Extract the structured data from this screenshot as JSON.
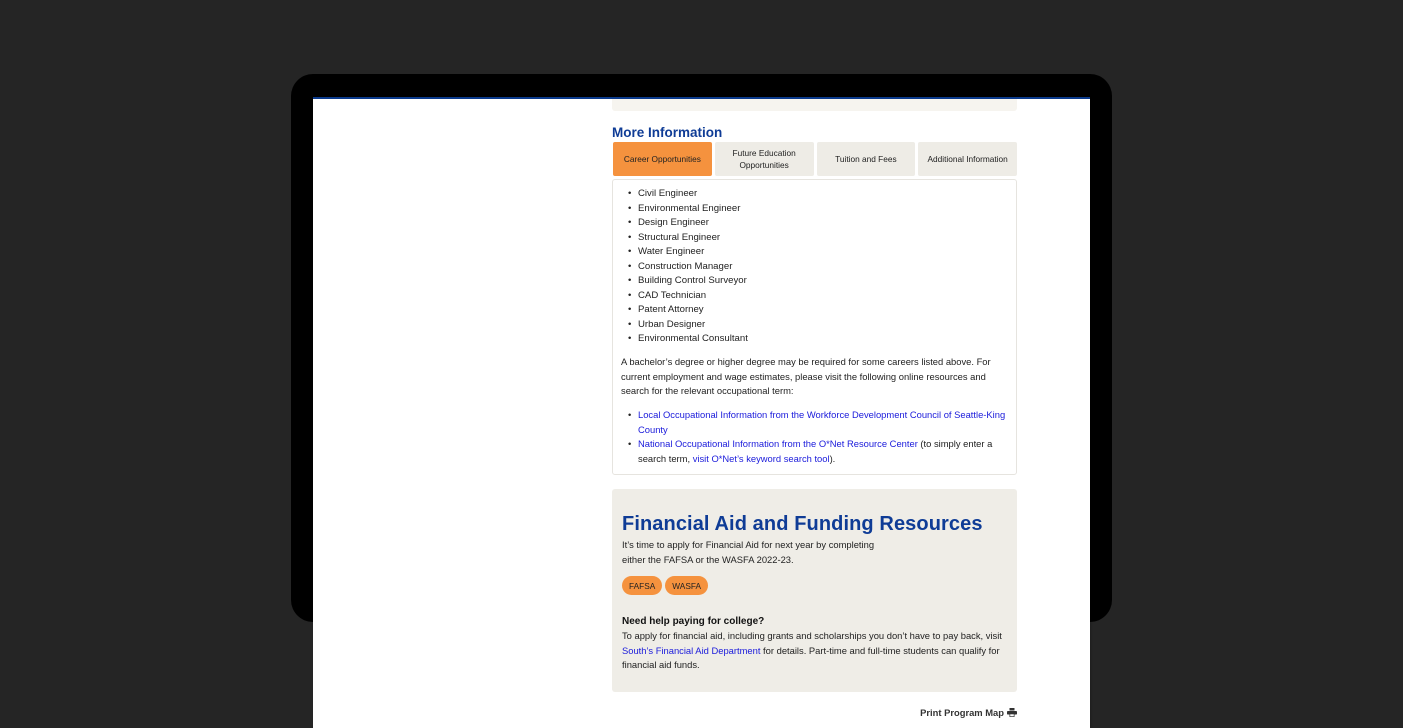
{
  "top_cut_text": "...",
  "more_info": {
    "title": "More Information",
    "tabs": [
      {
        "label": "Career Opportunities",
        "active": true
      },
      {
        "label": "Future Education Opportunities",
        "active": false
      },
      {
        "label": "Tuition and Fees",
        "active": false
      },
      {
        "label": "Additional Information",
        "active": false
      }
    ],
    "careers": [
      "Civil Engineer",
      "Environmental Engineer",
      "Design Engineer",
      "Structural Engineer",
      "Water Engineer",
      "Construction Manager",
      "Building Control Surveyor",
      "CAD Technician",
      "Patent Attorney",
      "Urban Designer",
      "Environmental Consultant"
    ],
    "paragraph": "A bachelor’s degree or higher degree may be required for some careers listed above. For current employment and wage estimates, please visit the following online resources and search for the relevant occupational term:",
    "links": {
      "local": "Local Occupational Information from the Workforce Development Council of Seattle-King County",
      "national": "National Occupational Information from the O*Net Resource Center",
      "national_suffix_before": " (to simply enter a search term, ",
      "keyword_tool": "visit O*Net’s keyword search tool",
      "national_suffix_after": ")."
    }
  },
  "financial": {
    "title": "Financial Aid and Funding Resources",
    "intro": "It’s time to apply for Financial Aid for next year by completing either the FAFSA or the WASFA 2022-23.",
    "buttons": [
      "FAFSA",
      "WASFA"
    ],
    "help_title": "Need help paying for college?",
    "help_before": "To apply for financial aid, including grants and scholarships you don’t have to pay back, visit ",
    "help_link": "South’s Financial Aid Department",
    "help_after": " for details. Part-time and full-time students can qualify for financial aid funds."
  },
  "print": {
    "label": "Print Program Map",
    "icon": "printer-icon"
  },
  "colors": {
    "accent": "#f5923e",
    "heading": "#0f3c96",
    "link": "#1a1adb",
    "panel_bg": "#efede7"
  }
}
